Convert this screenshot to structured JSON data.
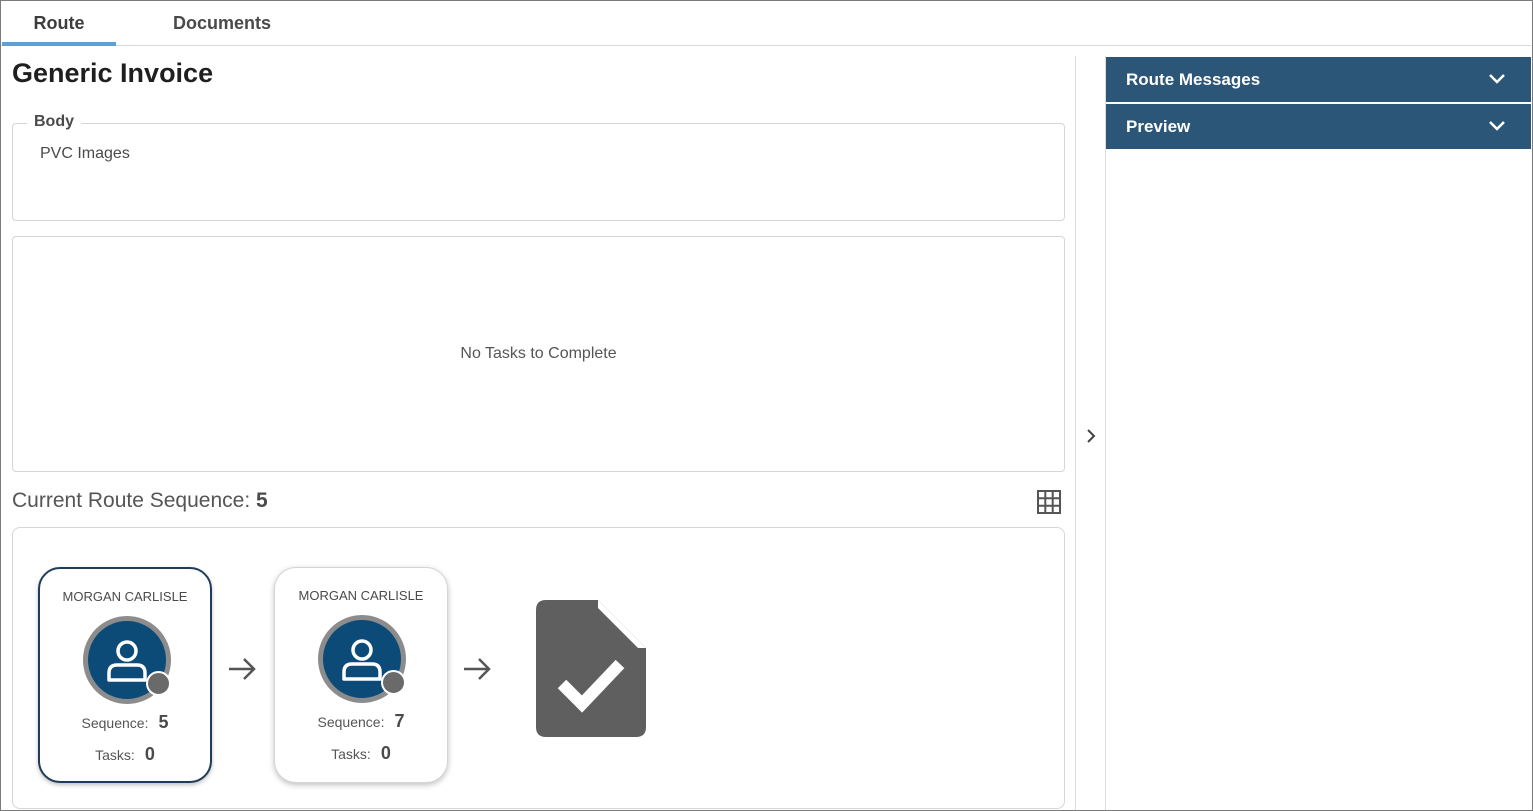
{
  "tabs": [
    {
      "label": "Route"
    },
    {
      "label": "Documents"
    }
  ],
  "page": {
    "title": "Generic Invoice"
  },
  "body": {
    "legend": "Body",
    "text": "PVC Images"
  },
  "tasks": {
    "empty_text": "No Tasks to Complete"
  },
  "route_sequence": {
    "label": "Current Route Sequence:",
    "value": "5"
  },
  "cards": [
    {
      "name": "MORGAN CARLISLE",
      "sequence_label": "Sequence:",
      "sequence": "5",
      "tasks_label": "Tasks:",
      "tasks": "0",
      "state": "active"
    },
    {
      "name": "MORGAN CARLISLE",
      "sequence_label": "Sequence:",
      "sequence": "7",
      "tasks_label": "Tasks:",
      "tasks": "0",
      "state": "inactive"
    }
  ],
  "right_panel": {
    "sections": [
      {
        "label": "Route Messages"
      },
      {
        "label": "Preview"
      }
    ]
  },
  "colors": {
    "accent": "#5ca0d8",
    "header": "#2c5678",
    "avatar": "#0c4a78",
    "active_border": "#1f3c5a"
  },
  "icons": [
    "grid-icon",
    "user-icon",
    "arrow-right-icon",
    "document-check-icon",
    "chevron-right-icon",
    "chevron-down-icon"
  ]
}
